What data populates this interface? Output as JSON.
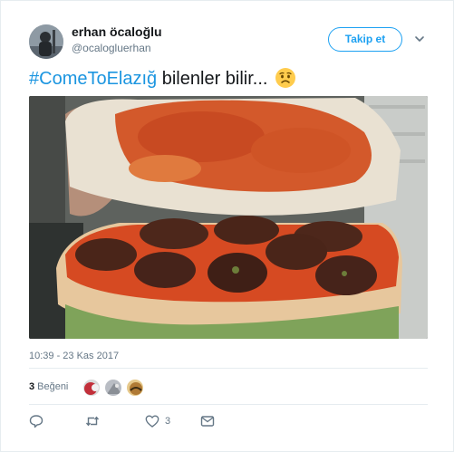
{
  "user": {
    "display_name": "erhan öcaloğlu",
    "handle": "@ocalogluerhan"
  },
  "follow_button": {
    "label": "Takip et"
  },
  "tweet": {
    "hashtag": "#ComeToElazığ",
    "text": " bilenler bilir...",
    "emoji": "worried-face-emoji",
    "timestamp": "10:39 - 23 Kas 2017"
  },
  "stats": {
    "likes_count": "3",
    "likes_label": "Beğeni"
  },
  "actions": {
    "reply_count": "",
    "retweet_count": "",
    "like_count": "3"
  },
  "colors": {
    "accent": "#1da1f2",
    "hashtag": "#1b95e0",
    "muted_text": "#657786",
    "divider": "#e6ecf0"
  },
  "icons": [
    "caret-down-icon",
    "reply-icon",
    "retweet-icon",
    "heart-icon",
    "direct-message-icon"
  ]
}
